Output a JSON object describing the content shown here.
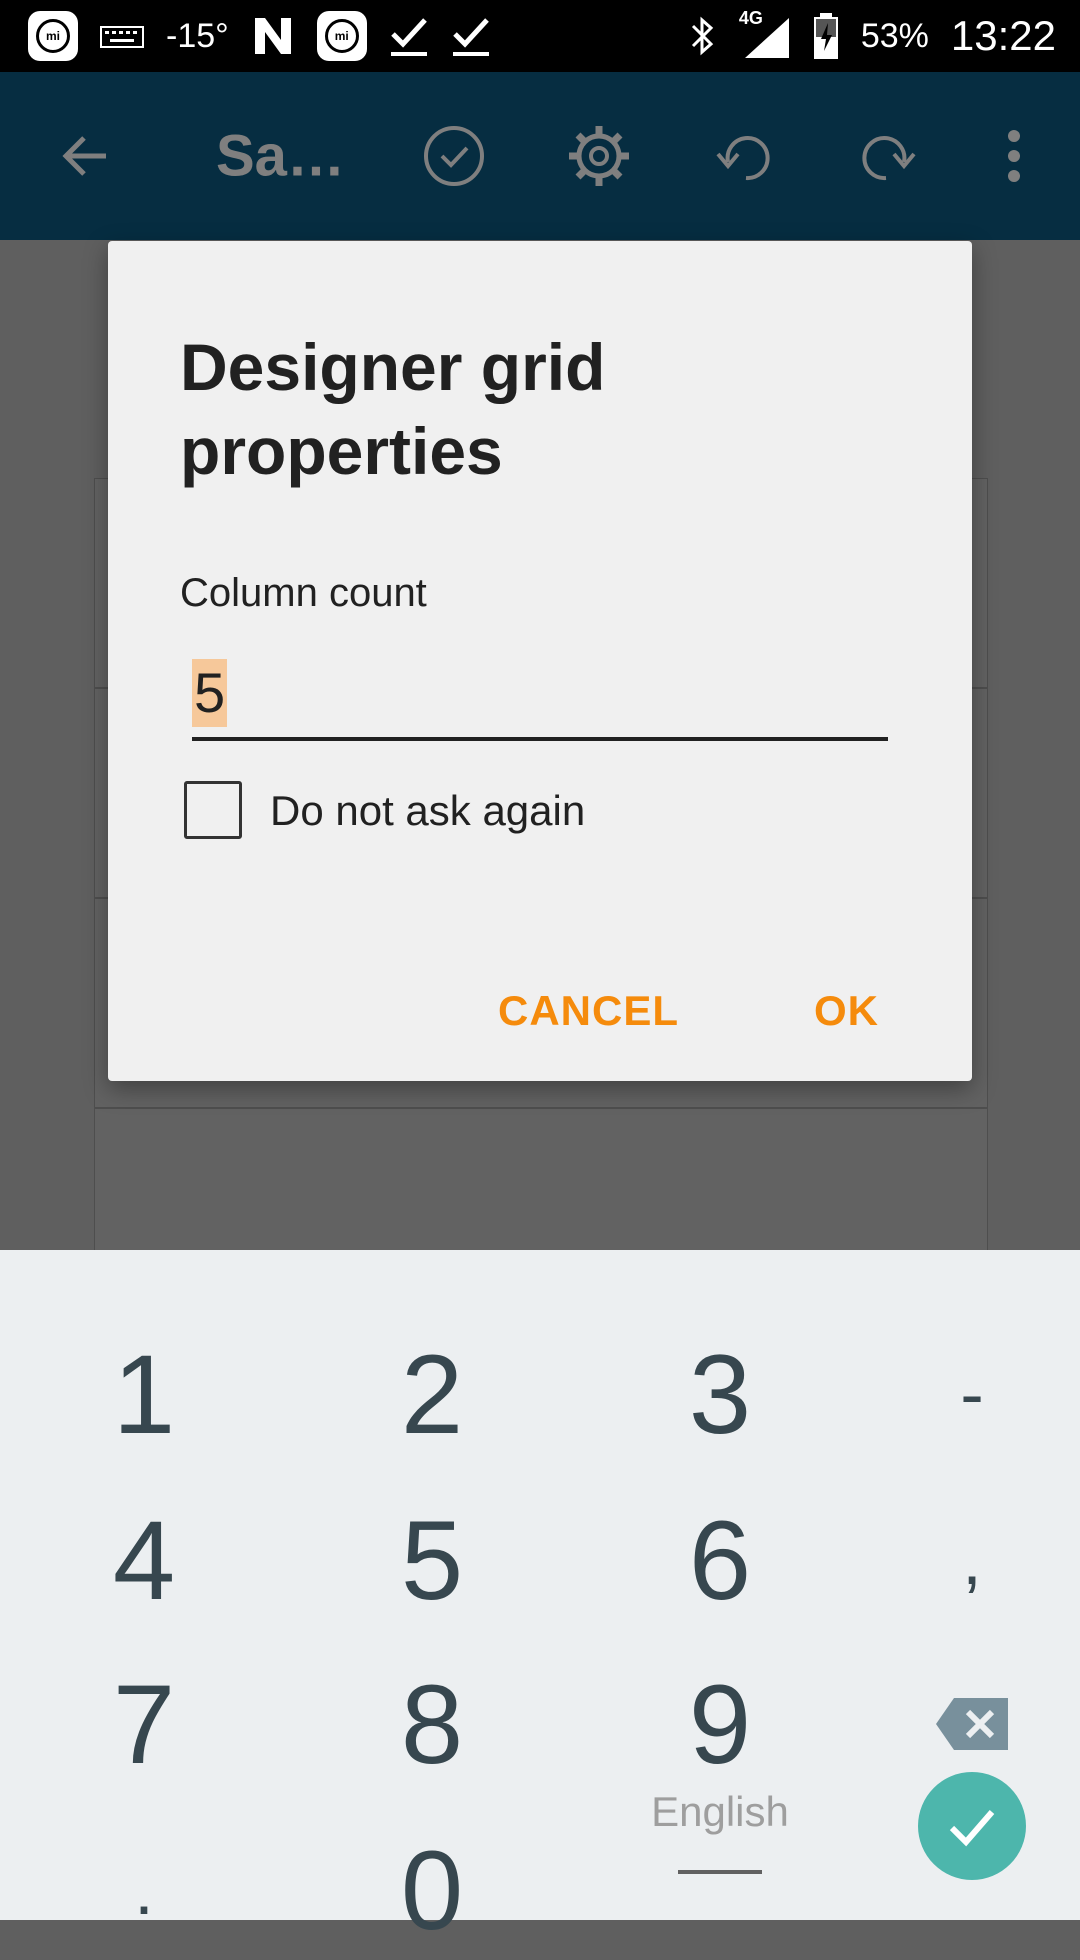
{
  "status_bar": {
    "temperature": "-15°",
    "network": "4G",
    "battery": "53%",
    "time": "13:22",
    "icons": [
      "mi-icon",
      "keyboard-icon",
      "n-icon",
      "mi-icon",
      "download-done-icon",
      "download-done-icon",
      "bluetooth-icon",
      "signal-icon",
      "battery-charging-icon"
    ]
  },
  "app_bar": {
    "title": "Sa…",
    "icons": [
      "back-arrow-icon",
      "check-circle-icon",
      "gear-icon",
      "undo-icon",
      "redo-icon",
      "overflow-menu-icon"
    ]
  },
  "dialog": {
    "title": "Designer grid properties",
    "field_label": "Column count",
    "field_value": "5",
    "checkbox_label": "Do not ask again",
    "checkbox_checked": false,
    "cancel_label": "CANCEL",
    "ok_label": "OK"
  },
  "keyboard": {
    "keys": [
      "1",
      "2",
      "3",
      "-",
      "4",
      "5",
      "6",
      ",",
      "7",
      "8",
      "9",
      "⌫",
      ".",
      "0"
    ],
    "language": "English",
    "accent_color": "#4db6ac"
  },
  "colors": {
    "accent": "#f58b0c",
    "app_bar": "#0d5a82"
  }
}
